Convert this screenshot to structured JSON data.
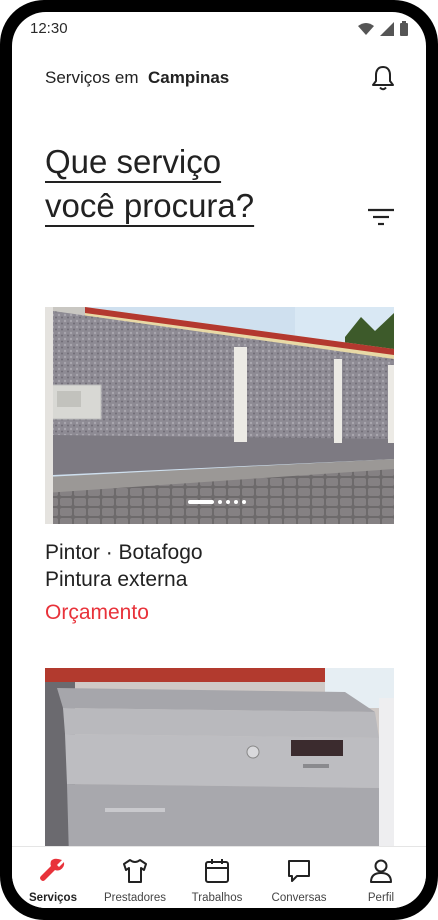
{
  "status_bar": {
    "time": "12:30"
  },
  "header": {
    "prefix": "Serviços em",
    "city": "Campinas"
  },
  "title": {
    "line1": "Que serviço",
    "line2": "você procura?"
  },
  "listings": [
    {
      "service": "Pintor · Botafogo",
      "subtitle": "Pintura externa",
      "price_label": "Orçamento"
    }
  ],
  "nav": [
    {
      "label": "Serviços",
      "icon": "wrench-icon",
      "active": true
    },
    {
      "label": "Prestadores",
      "icon": "shirt-icon"
    },
    {
      "label": "Trabalhos",
      "icon": "calendar-icon"
    },
    {
      "label": "Conversas",
      "icon": "chat-icon"
    },
    {
      "label": "Perfil",
      "icon": "user-icon"
    }
  ],
  "colors": {
    "accent": "#e8323a",
    "text": "#222222"
  }
}
